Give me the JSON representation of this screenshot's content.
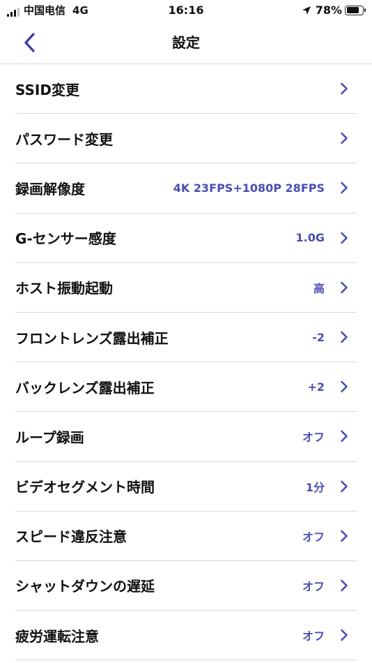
{
  "status_bar": {
    "carrier": "中国电信",
    "network": "4G",
    "time": "16:16",
    "battery_percent": "78%",
    "battery_level": 0.78,
    "signal_bars_active": 3
  },
  "header": {
    "title": "設定",
    "back_icon": "chevron-left-icon"
  },
  "colors": {
    "accent": "#4a4db3",
    "text": "#111111",
    "divider": "#d9d9d9"
  },
  "settings": [
    {
      "label": "SSID変更",
      "value": ""
    },
    {
      "label": "パスワード変更",
      "value": ""
    },
    {
      "label": "録画解像度",
      "value": "4K 23FPS+1080P 28FPS"
    },
    {
      "label": "G-センサー感度",
      "value": "1.0G"
    },
    {
      "label": "ホスト振動起動",
      "value": "高"
    },
    {
      "label": "フロントレンズ露出補正",
      "value": "-2"
    },
    {
      "label": "バックレンズ露出補正",
      "value": "+2"
    },
    {
      "label": "ループ録画",
      "value": "オフ"
    },
    {
      "label": "ビデオセグメント時間",
      "value": "1分"
    },
    {
      "label": "スピード違反注意",
      "value": "オフ"
    },
    {
      "label": "シャットダウンの遅延",
      "value": "オフ"
    },
    {
      "label": "疲労運転注意",
      "value": "オフ"
    }
  ]
}
